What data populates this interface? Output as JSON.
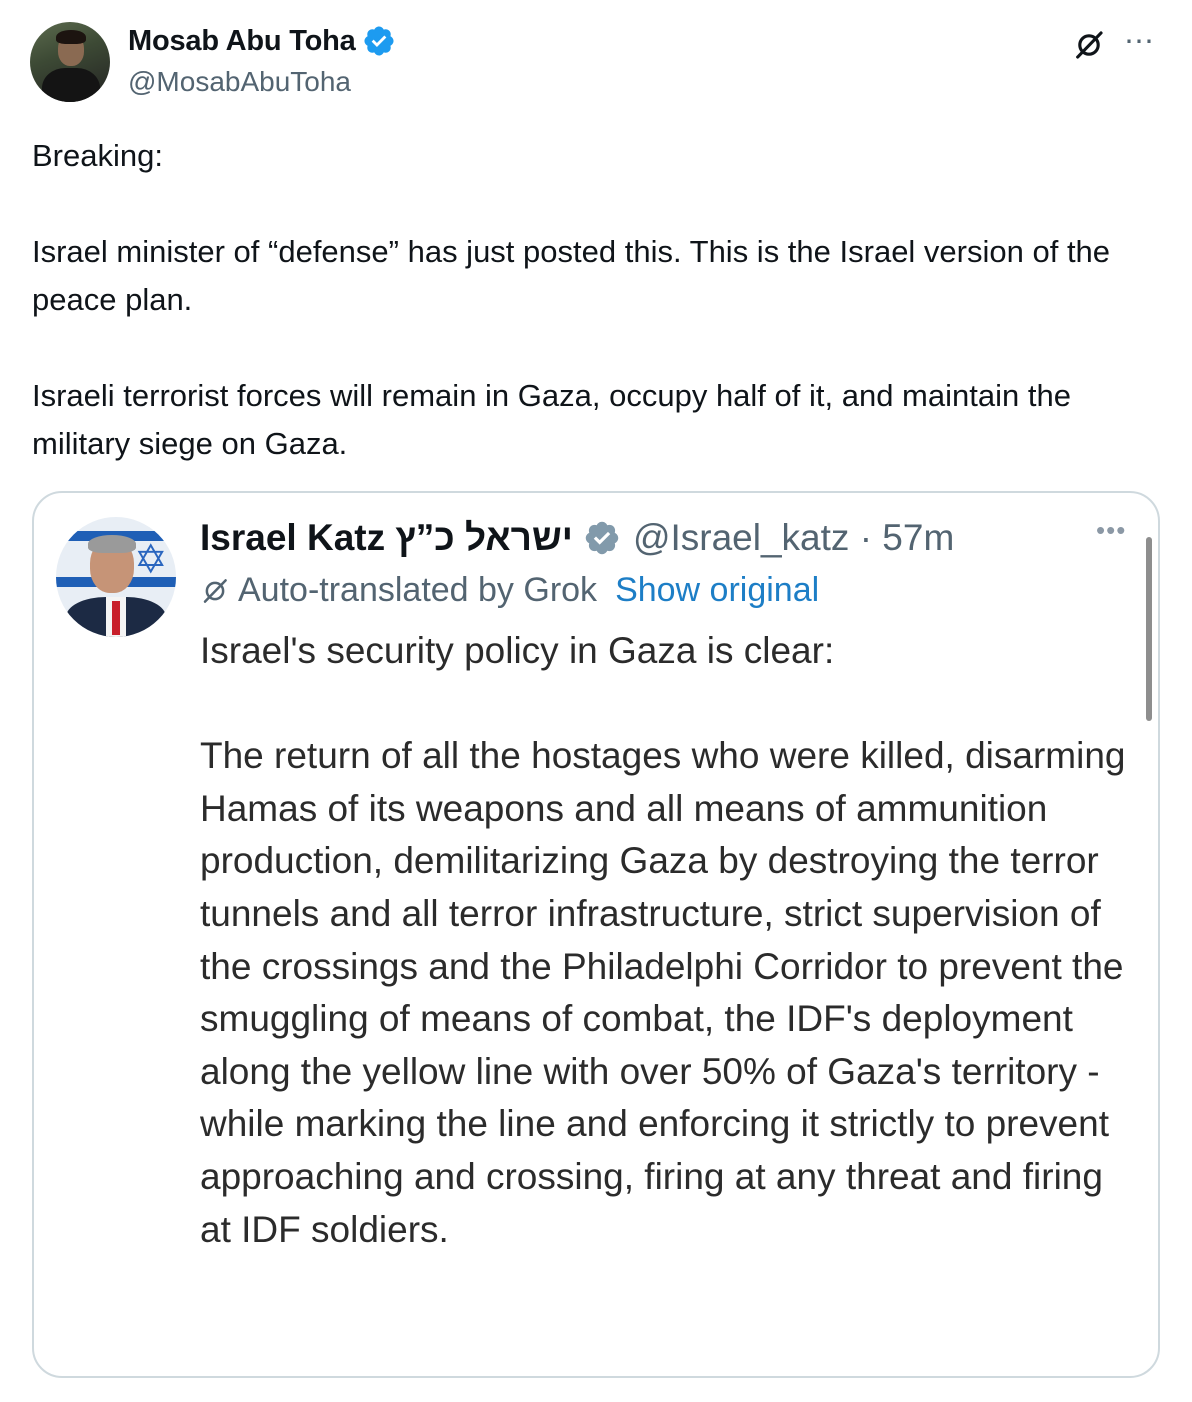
{
  "author": {
    "name": "Mosab Abu Toha",
    "handle": "@MosabAbuToha"
  },
  "post": {
    "paragraphs": [
      "Breaking:",
      "Israel minister of “defense” has just posted this. This is the Israel version of the peace plan.",
      "Israeli terrorist forces will remain in Gaza, occupy half of it, and maintain the military siege on Gaza."
    ]
  },
  "quote": {
    "name": "Israel Katz ישראל כ”ץ",
    "handle_time": "@Israel_katz · 57m",
    "translate_label": "Auto-translated by Grok",
    "show_original": "Show original",
    "paragraphs": [
      "Israel's security policy in Gaza is clear:",
      "The return of all the hostages who were killed, disarming Hamas of its weapons and all means of ammunition production, demilitarizing Gaza by destroying the terror tunnels and all terror infrastructure, strict supervision of the crossings and the Philadelphi Corridor to prevent the smuggling of means of combat, the IDF's deployment along the yellow line with over 50% of Gaza's territory - while marking the line and enforcing it strictly to prevent approaching and crossing, firing at any threat and firing at IDF soldiers."
    ]
  },
  "icons": {
    "verified": "verified-badge-icon",
    "grok": "grok-icon",
    "more": "more-icon"
  },
  "colors": {
    "verified_blue": "#1d9bf0",
    "link_blue": "#1d7ec6",
    "muted_gray": "#536471",
    "border": "#cfd9de"
  }
}
